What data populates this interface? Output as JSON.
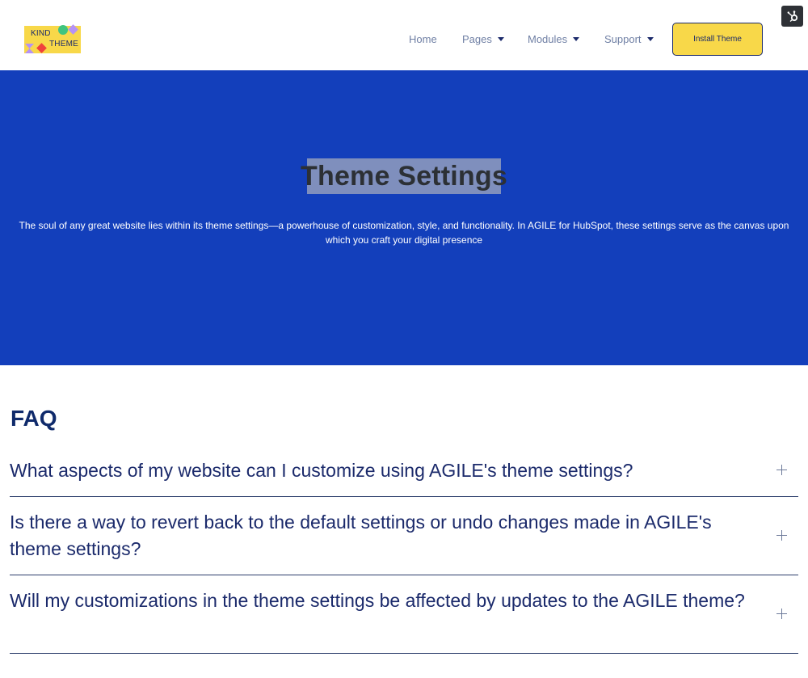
{
  "header": {
    "logo": {
      "line1": "KIND",
      "line2": "THEME"
    },
    "nav": [
      {
        "label": "Home",
        "dropdown": false
      },
      {
        "label": "Pages",
        "dropdown": true
      },
      {
        "label": "Modules",
        "dropdown": true
      },
      {
        "label": "Support",
        "dropdown": true
      }
    ],
    "install_label": "Install Theme",
    "hubspot_icon": "hubspot-sprocket-icon"
  },
  "hero": {
    "title": "Theme Settings",
    "description": "The soul of any great website lies within its theme settings—a powerhouse of customization, style, and functionality. In AGILE for HubSpot, these settings serve as the canvas upon which you craft your digital presence"
  },
  "faq": {
    "heading": "FAQ",
    "items": [
      {
        "question": "What aspects of my website can I customize using AGILE's theme settings?"
      },
      {
        "question": "Is there a way to revert back to the default settings or undo changes made in AGILE's theme settings?"
      },
      {
        "question": "Will my customizations in the theme settings be affected by updates to the AGILE theme?"
      }
    ]
  },
  "colors": {
    "hero_bg": "#133fbb",
    "accent_yellow": "#f8d849",
    "navy": "#1b2a6b",
    "title_highlight": "#7f8fbd"
  }
}
